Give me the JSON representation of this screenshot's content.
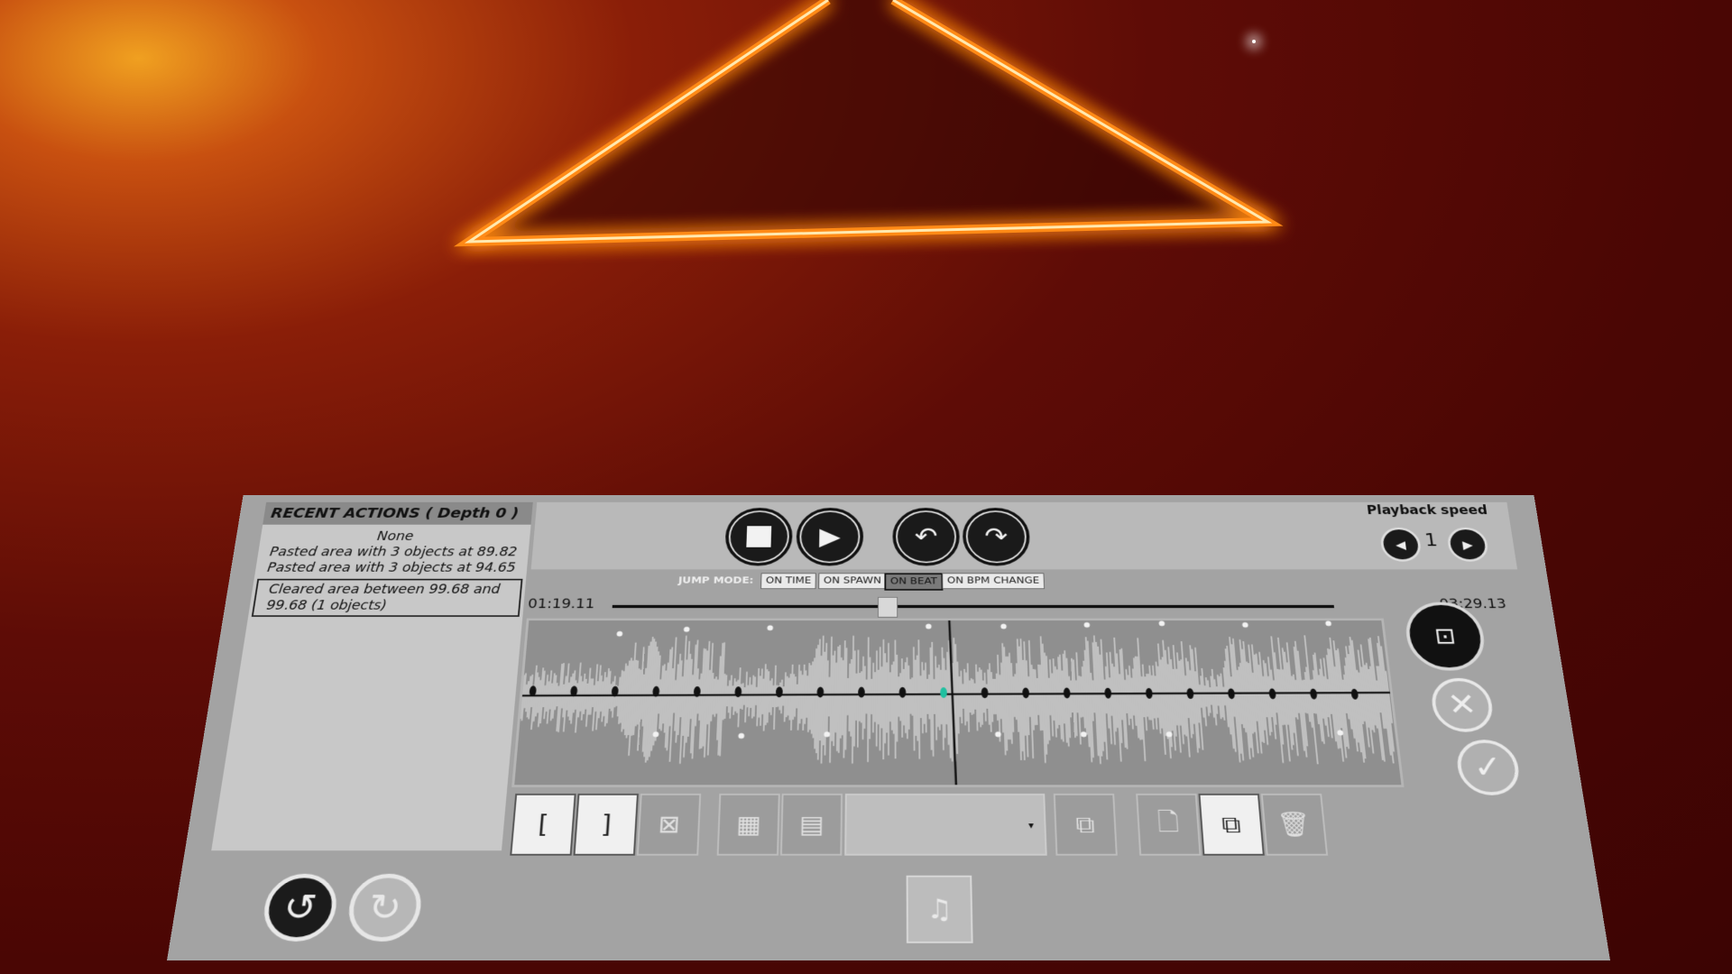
{
  "recent_actions": {
    "title": "RECENT ACTIONS ( Depth 0 )",
    "items": [
      "None",
      "Pasted area with 3 objects at 89.82",
      "Pasted area with 3 objects at 94.65",
      "Cleared area between 99.68 and 99.68 (1 objects)"
    ]
  },
  "playback": {
    "speed_label": "Playback speed",
    "speed_value": "1",
    "current_time": "01:19.11",
    "end_time": "03:29.13",
    "progress": 0.38
  },
  "jump_mode": {
    "label": "JUMP MODE:",
    "options": [
      "ON TIME",
      "ON SPAWN",
      "ON BEAT",
      "ON BPM CHANGE"
    ],
    "active": "ON BEAT"
  },
  "icons": {
    "stop": "stop-icon",
    "play": "play-icon",
    "rewind": "curved-arrow-left-icon",
    "forward": "curved-arrow-right-icon",
    "speed_down": "speed-down-icon",
    "speed_up": "speed-up-icon",
    "select": "selection-nodes-icon",
    "cancel": "close-icon",
    "confirm": "check-icon",
    "undo": "undo-icon",
    "redo": "redo-icon",
    "music_add": "music-note-add-icon"
  },
  "colors": {
    "accent_marker": "#20c0a0",
    "glow_orange": "#ff9a1a"
  }
}
